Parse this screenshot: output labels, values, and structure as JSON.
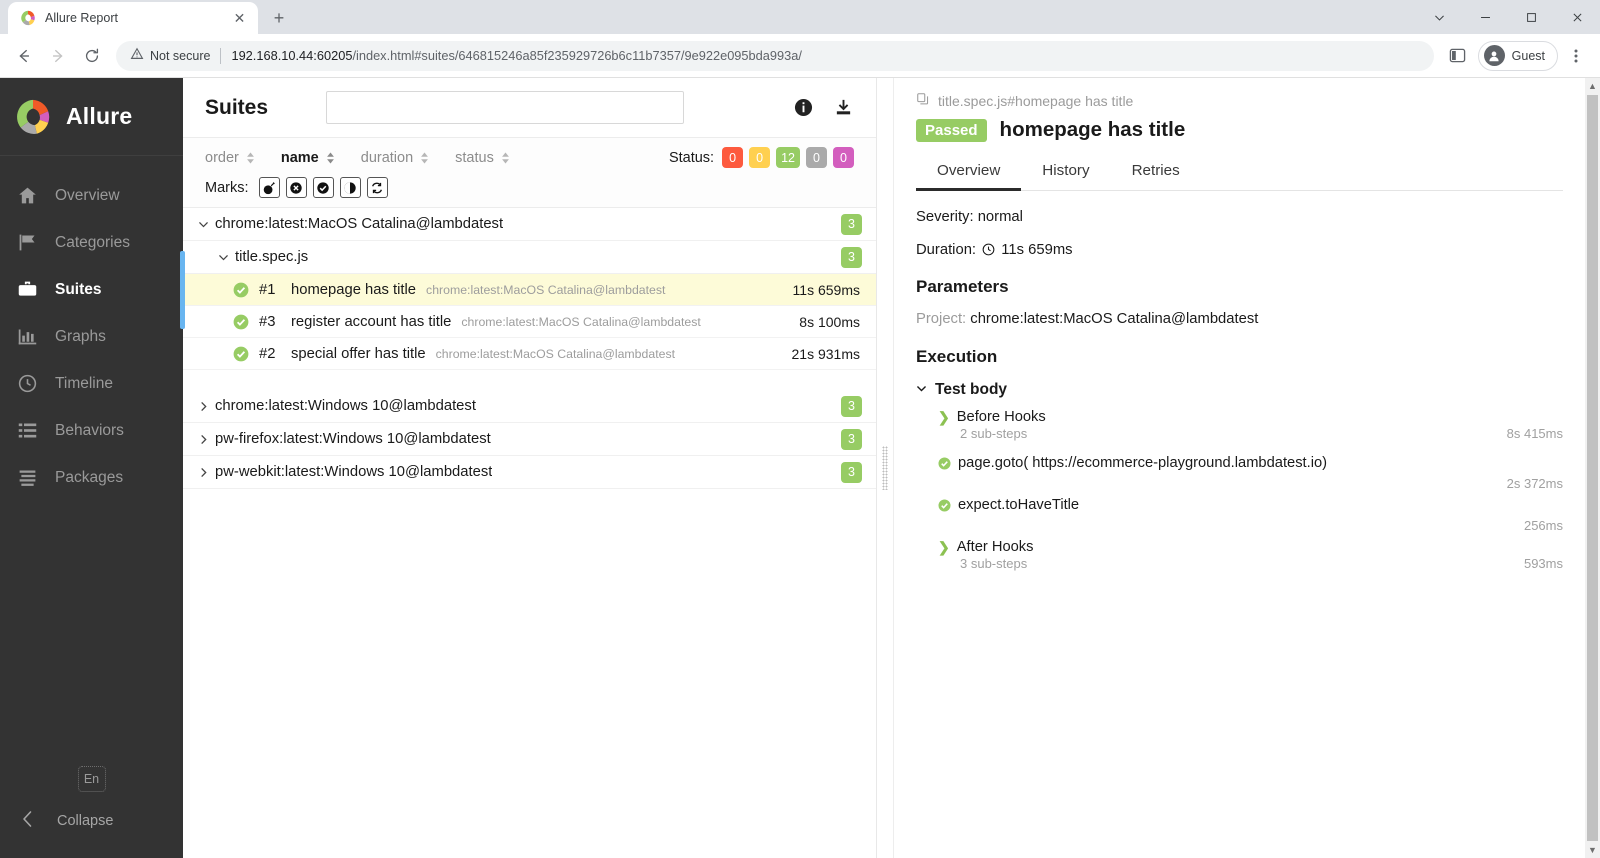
{
  "browser": {
    "tab_title": "Allure Report",
    "tab_close_icon": "close-icon",
    "new_tab_icon": "plus-icon",
    "back_icon": "arrow-left-icon",
    "forward_icon": "arrow-right-icon",
    "reload_icon": "reload-icon",
    "security_text": "Not secure",
    "security_icon": "warning-triangle-icon",
    "url_host": "192.168.10.44:60205",
    "url_path": "/index.html#suites/646815246a85f235929726b6c11b7357/9e922e095bda993a/",
    "side_panel_icon": "side-panel-icon",
    "profile_label": "Guest",
    "menu_icon": "kebab-menu-icon",
    "window_minimize_icon": "minimize-icon",
    "window_maximize_icon": "maximize-icon",
    "window_close_icon": "window-close-icon",
    "window_more_icon": "chevron-down-icon"
  },
  "sidebar": {
    "brand": "Allure",
    "items": [
      {
        "label": "Overview",
        "icon": "home-icon",
        "active": false
      },
      {
        "label": "Categories",
        "icon": "flag-icon",
        "active": false
      },
      {
        "label": "Suites",
        "icon": "briefcase-icon",
        "active": true
      },
      {
        "label": "Graphs",
        "icon": "bar-chart-icon",
        "active": false
      },
      {
        "label": "Timeline",
        "icon": "clock-icon",
        "active": false
      },
      {
        "label": "Behaviors",
        "icon": "list-icon",
        "active": false
      },
      {
        "label": "Packages",
        "icon": "layers-icon",
        "active": false
      }
    ],
    "language": "En",
    "collapse_label": "Collapse",
    "collapse_icon": "chevron-left-icon"
  },
  "suites": {
    "title": "Suites",
    "search_placeholder": "",
    "search_value": "",
    "info_icon": "info-icon",
    "download_icon": "download-icon",
    "sort": [
      {
        "label": "order",
        "active": false
      },
      {
        "label": "name",
        "active": true
      },
      {
        "label": "duration",
        "active": false
      },
      {
        "label": "status",
        "active": false
      }
    ],
    "status_label": "Status:",
    "status_chips": [
      {
        "value": "0",
        "name": "failed",
        "color": "#fd5a3e"
      },
      {
        "value": "0",
        "name": "broken",
        "color": "#ffd050"
      },
      {
        "value": "12",
        "name": "passed",
        "color": "#97cc64"
      },
      {
        "value": "0",
        "name": "skipped",
        "color": "#aaaaaa"
      },
      {
        "value": "0",
        "name": "unknown",
        "color": "#d35ebe"
      }
    ],
    "marks_label": "Marks:",
    "marks": [
      {
        "name": "flaky-mark-icon",
        "glyph": "bomb"
      },
      {
        "name": "failed-mark-icon",
        "glyph": "xcircle"
      },
      {
        "name": "passed-mark-icon",
        "glyph": "check"
      },
      {
        "name": "newfailed-mark-icon",
        "glyph": "half"
      },
      {
        "name": "retry-mark-icon",
        "glyph": "retry"
      }
    ],
    "tree": [
      {
        "label": "chrome:latest:MacOS Catalina@lambdatest",
        "count": "3",
        "expanded": true,
        "children": [
          {
            "label": "title.spec.js",
            "count": "3",
            "expanded": true,
            "tests": [
              {
                "num": "#1",
                "name": "homepage has title",
                "meta": "chrome:latest:MacOS Catalina@lambdatest",
                "duration": "11s 659ms",
                "selected": true,
                "status": "passed"
              },
              {
                "num": "#3",
                "name": "register account has title",
                "meta": "chrome:latest:MacOS Catalina@lambdatest",
                "duration": "8s 100ms",
                "selected": false,
                "status": "passed"
              },
              {
                "num": "#2",
                "name": "special offer has title",
                "meta": "chrome:latest:MacOS Catalina@lambdatest",
                "duration": "21s 931ms",
                "selected": false,
                "status": "passed"
              }
            ]
          }
        ]
      },
      {
        "label": "chrome:latest:Windows 10@lambdatest",
        "count": "3",
        "expanded": false,
        "children": []
      },
      {
        "label": "pw-firefox:latest:Windows 10@lambdatest",
        "count": "3",
        "expanded": false,
        "children": []
      },
      {
        "label": "pw-webkit:latest:Windows 10@lambdatest",
        "count": "3",
        "expanded": false,
        "children": []
      }
    ]
  },
  "detail": {
    "breadcrumb": "title.spec.js#homepage has title",
    "breadcrumb_icon": "copy-icon",
    "status_badge": "Passed",
    "title": "homepage has title",
    "tabs": [
      {
        "label": "Overview",
        "active": true
      },
      {
        "label": "History",
        "active": false
      },
      {
        "label": "Retries",
        "active": false
      }
    ],
    "severity_label": "Severity:",
    "severity_value": "normal",
    "duration_label": "Duration:",
    "duration_icon": "clock-icon",
    "duration_value": "11s 659ms",
    "parameters_heading": "Parameters",
    "parameters": [
      {
        "name": "Project:",
        "value": "chrome:latest:MacOS Catalina@lambdatest"
      }
    ],
    "execution_heading": "Execution",
    "test_body_label": "Test body",
    "steps": [
      {
        "title": "Before Hooks",
        "sub": "2 sub-steps",
        "duration": "8s 415ms",
        "kind": "group"
      },
      {
        "title": "page.goto( https://ecommerce-playground.lambdatest.io)",
        "sub": "",
        "duration": "2s 372ms",
        "kind": "passed"
      },
      {
        "title": "expect.toHaveTitle",
        "sub": "",
        "duration": "256ms",
        "kind": "passed"
      },
      {
        "title": "After Hooks",
        "sub": "3 sub-steps",
        "duration": "593ms",
        "kind": "group"
      }
    ]
  }
}
